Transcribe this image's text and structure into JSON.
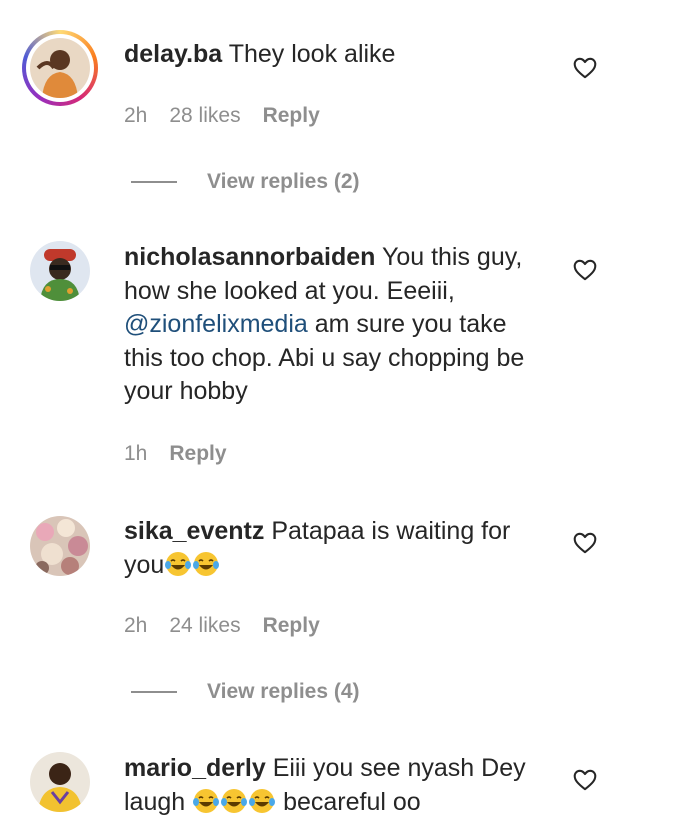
{
  "comments": [
    {
      "username": "delay.ba",
      "text": "They look alike",
      "time": "2h",
      "likes": "28 likes",
      "reply": "Reply",
      "view_replies": "View replies (2)"
    },
    {
      "username": "nicholasannorbaiden",
      "text_1": "You this guy, how she looked at you. Eeeiii,",
      "mention": "@zionfelixmedia",
      "text_2": "am sure you take this too chop. Abi u say chopping be your hobby",
      "time": "1h",
      "reply": "Reply"
    },
    {
      "username": "sika_eventz",
      "text": "Patapaa is waiting for you",
      "time": "2h",
      "likes": "24 likes",
      "reply": "Reply",
      "view_replies": "View replies (4)"
    },
    {
      "username": "mario_derly",
      "text_1": "Eiii you see nyash Dey laugh",
      "text_2": "becareful oo"
    }
  ],
  "icons": {
    "like": "heart-outline-icon",
    "emoji": "face-with-tears-of-joy-emoji"
  },
  "colors": {
    "text": "#262626",
    "secondary": "#8e8e8e",
    "mention": "#1f4f7a"
  }
}
